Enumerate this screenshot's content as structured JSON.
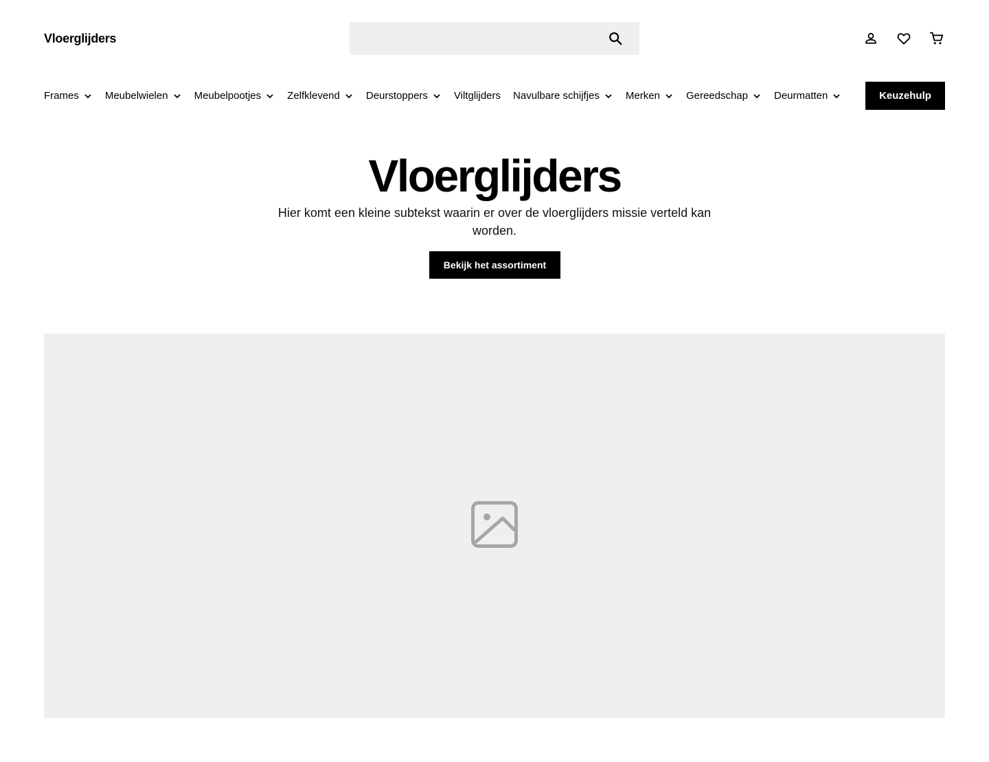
{
  "brand": {
    "name": "Vloerglijders"
  },
  "search": {
    "placeholder": "",
    "value": "",
    "icon": "search-icon"
  },
  "header_icons": [
    "account-icon",
    "heart-icon",
    "cart-icon"
  ],
  "nav": {
    "items": [
      {
        "label": "Frames",
        "has_dropdown": true
      },
      {
        "label": "Meubelwielen",
        "has_dropdown": true
      },
      {
        "label": "Meubelpootjes",
        "has_dropdown": true
      },
      {
        "label": "Zelfklevend",
        "has_dropdown": true
      },
      {
        "label": "Deurstoppers",
        "has_dropdown": true
      },
      {
        "label": "Viltglijders",
        "has_dropdown": false
      },
      {
        "label": "Navulbare schijfjes",
        "has_dropdown": true
      },
      {
        "label": "Merken",
        "has_dropdown": true
      },
      {
        "label": "Gereedschap",
        "has_dropdown": true
      },
      {
        "label": "Deurmatten",
        "has_dropdown": true
      }
    ],
    "cta_label": "Keuzehulp"
  },
  "hero": {
    "title": "Vloerglijders",
    "subtitle": "Hier komt een kleine subtekst waarin er over de vloerglijders missie verteld kan worden.",
    "button_label": "Bekijk het assortiment"
  },
  "media": {
    "icon": "image-placeholder-icon"
  },
  "colors": {
    "primary": "#000000",
    "background": "#ffffff",
    "surface": "#efefef",
    "icon_muted": "#a6a6a6"
  }
}
